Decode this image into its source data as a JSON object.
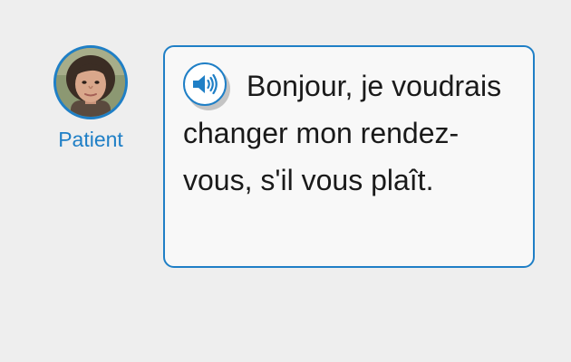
{
  "speaker": {
    "name": "Patient"
  },
  "message": {
    "text": "Bonjour, je voudrais changer mon rendez-vous, s'il vous plaît."
  },
  "icons": {
    "audio": "speaker-volume-icon"
  },
  "colors": {
    "accent": "#1f7fc6",
    "background": "#eeeeee",
    "bubble": "#f8f8f8",
    "text": "#1a1a1a"
  }
}
